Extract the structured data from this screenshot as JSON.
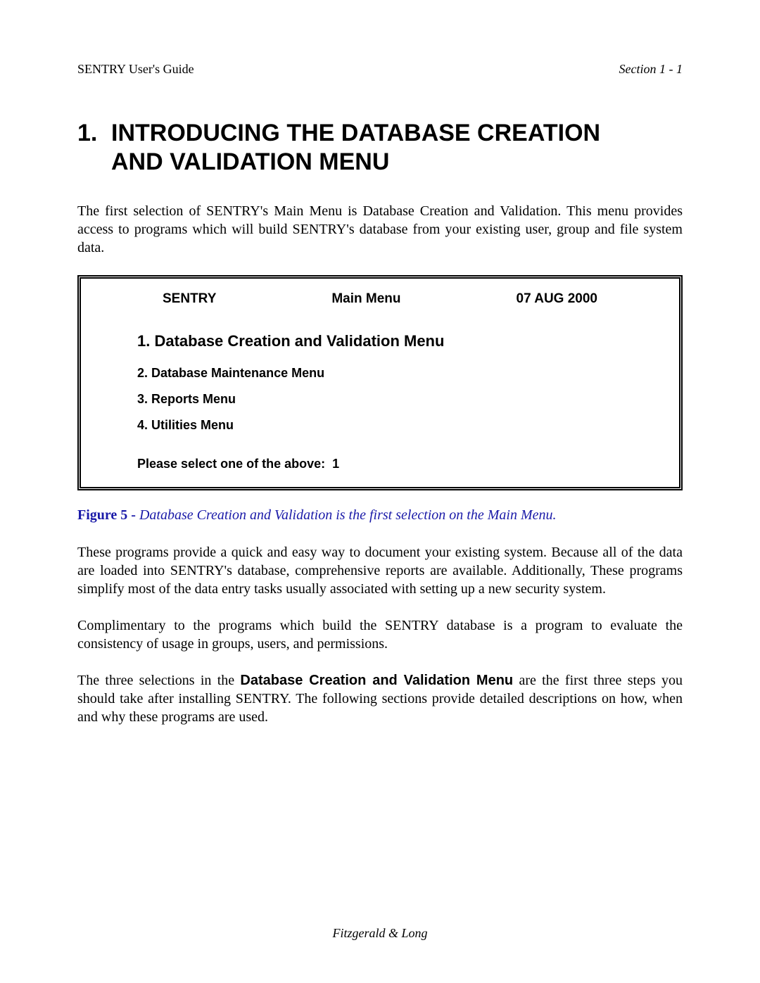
{
  "header": {
    "left": "SENTRY User's Guide",
    "right": "Section 1 - 1"
  },
  "title": {
    "number": "1.",
    "line1": "INTRODUCING THE DATABASE CREATION",
    "line2": "AND VALIDATION MENU"
  },
  "intro_paragraph": "The first selection of SENTRY's Main Menu is Database Creation and Validation.  This menu provides access to programs which will build SENTRY's database from your existing user, group and file system data.",
  "menu": {
    "app": "SENTRY",
    "title": "Main Menu",
    "date": "07 AUG 2000",
    "items": [
      "1. Database Creation and Validation Menu",
      "2. Database Maintenance Menu",
      "3. Reports Menu",
      "4. Utilities Menu"
    ],
    "prompt_label": "Please select one of the above:",
    "prompt_value": "1"
  },
  "figure": {
    "label": "Figure 5 - ",
    "text": "Database Creation and Validation is the first selection on the Main Menu."
  },
  "para2": "These programs provide a quick and easy way to document your existing system.  Because all of the data are loaded into SENTRY's database, comprehensive reports are available.  Additionally, These programs simplify most of the data entry tasks usually associated with setting up a new security system.",
  "para3": "Complimentary to the programs which build the SENTRY database is a program to evaluate the consistency of usage in groups, users, and permissions.",
  "para4": {
    "pre": "The three selections in the ",
    "bold": "Database Creation and Validation Menu",
    "post": " are the first three steps you should take after installing SENTRY.  The following sections provide detailed descriptions on how, when and why these programs are used."
  },
  "footer": "Fitzgerald & Long"
}
